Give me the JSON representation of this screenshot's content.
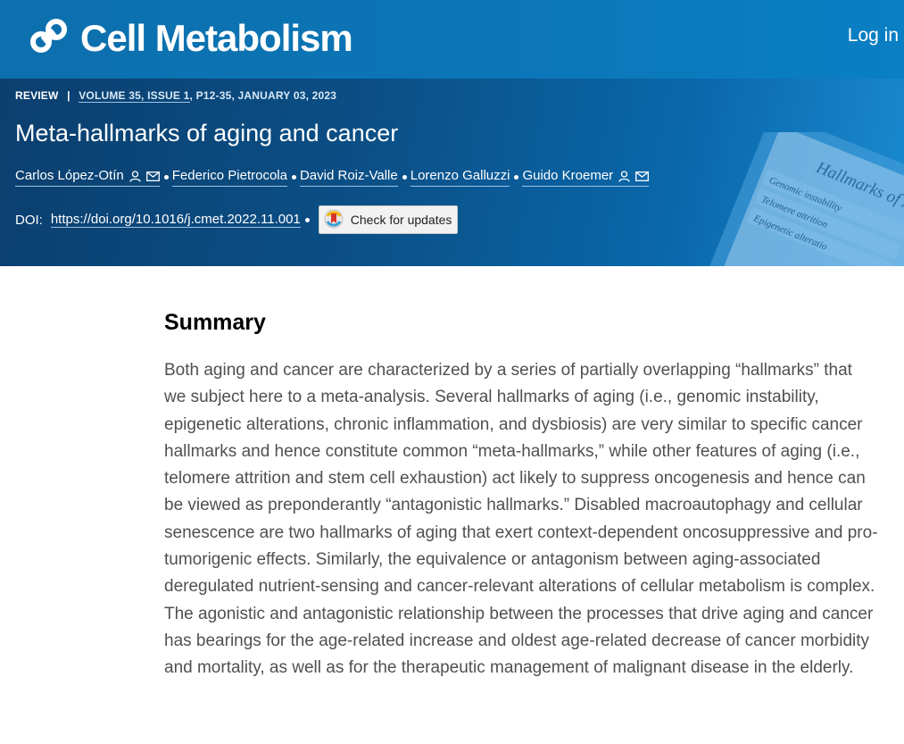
{
  "header": {
    "brand": "Cell Metabolism",
    "login_label": "Log in"
  },
  "article": {
    "type": "REVIEW",
    "meta_separator": "|",
    "volume_issue": "VOLUME 35, ISSUE 1",
    "pages_date": ", P12-35, JANUARY 03, 2023",
    "title": "Meta-hallmarks of aging and cancer",
    "authors": [
      {
        "name": "Carlos López-Otín",
        "has_contact": true
      },
      {
        "name": "Federico Pietrocola",
        "has_contact": false
      },
      {
        "name": "David Roiz-Valle",
        "has_contact": false
      },
      {
        "name": "Lorenzo Galluzzi",
        "has_contact": false
      },
      {
        "name": "Guido Kroemer",
        "has_contact": true
      }
    ],
    "doi_label": "DOI:",
    "doi_url": "https://doi.org/10.1016/j.cmet.2022.11.001",
    "check_updates_label": "Check for updates"
  },
  "hero_image": {
    "title": "Hallmarks of Aging",
    "items": [
      "Genomic instability",
      "Telomere attrition",
      "Epigenetic alteratio"
    ]
  },
  "summary": {
    "heading": "Summary",
    "text": "Both aging and cancer are characterized by a series of partially overlapping “hallmarks” that we subject here to a meta-analysis. Several hallmarks of aging (i.e., genomic instability, epigenetic alterations, chronic inflammation, and dysbiosis) are very similar to specific cancer hallmarks and hence constitute common “meta-hallmarks,” while other features of aging (i.e., telomere attrition and stem cell exhaustion) act likely to suppress oncogenesis and hence can be viewed as preponderantly “antagonistic hallmarks.” Disabled macroautophagy and cellular senescence are two hallmarks of aging that exert context-dependent oncosuppressive and pro-tumorigenic effects. Similarly, the equivalence or antagonism between aging-associated deregulated nutrient-sensing and cancer-relevant alterations of cellular metabolism is complex. The agonistic and antagonistic relationship between the processes that drive aging and cancer has bearings for the age-related increase and oldest age-related decrease of cancer morbidity and mortality, as well as for the therapeutic management of malignant disease in the elderly."
  },
  "colors": {
    "header_blue": "#0b77b8",
    "hero_dark": "#0b4f86",
    "summary_text": "#505050"
  }
}
